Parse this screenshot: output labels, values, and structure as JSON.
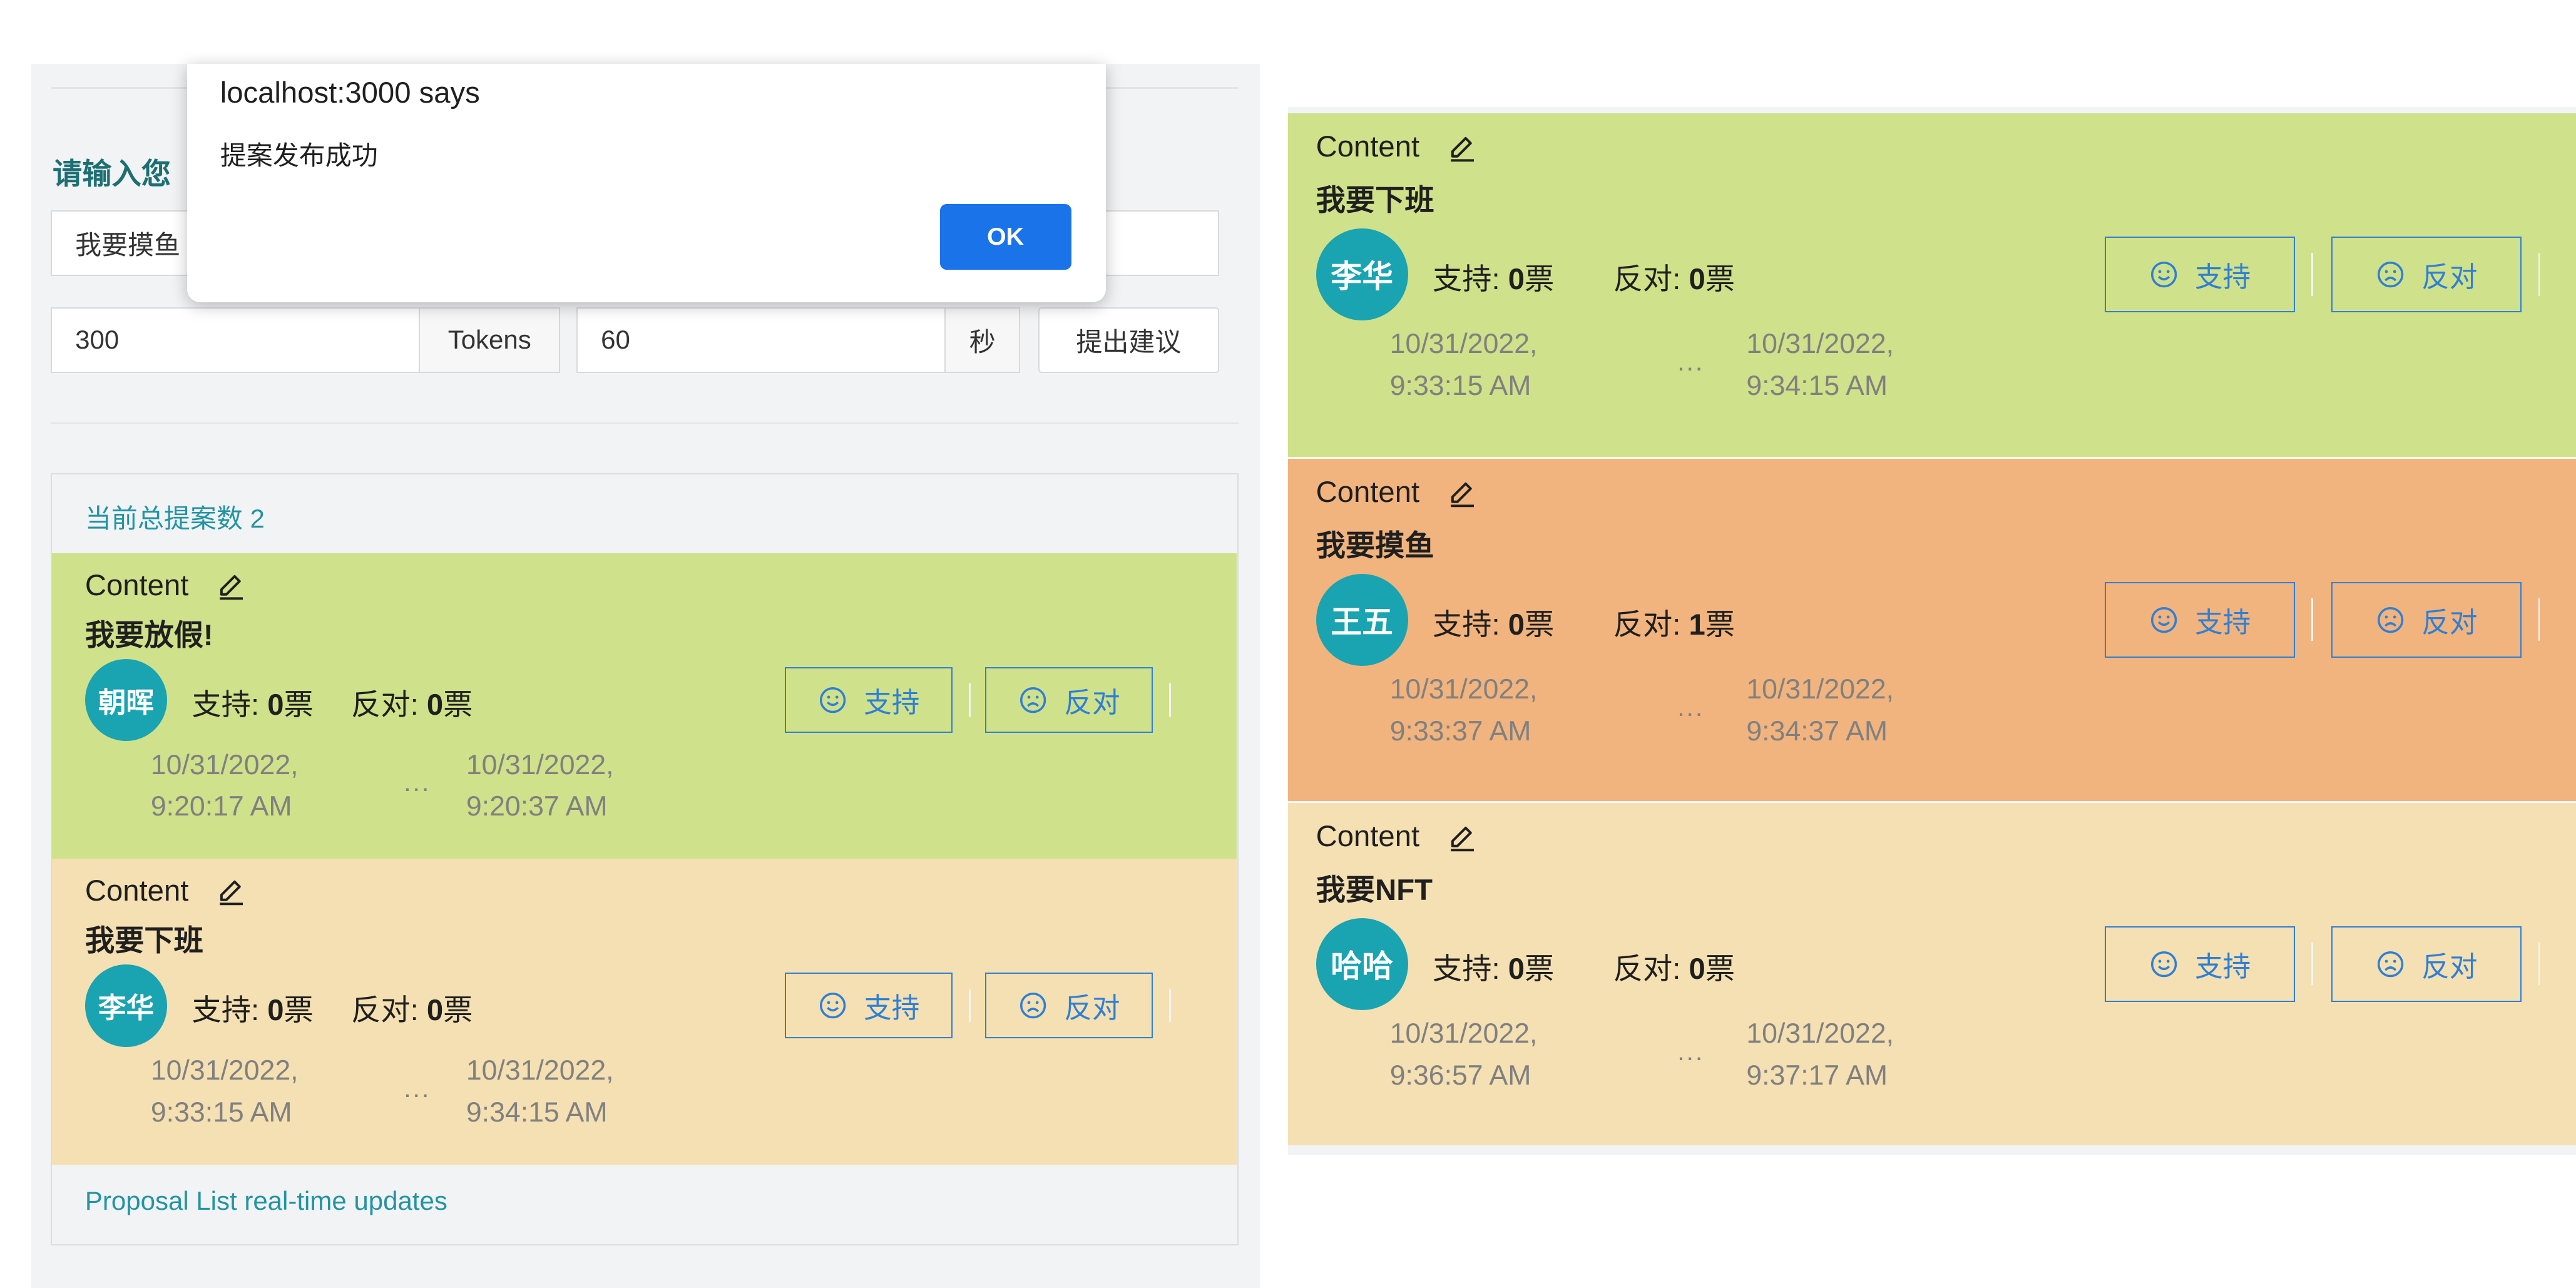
{
  "dialog": {
    "title": "localhost:3000 says",
    "message": "提案发布成功",
    "ok_label": "OK"
  },
  "form": {
    "prompt_title": "请输入您",
    "proposal_value": "我要摸鱼",
    "amount_value": "300",
    "amount_unit": "Tokens",
    "duration_value": "60",
    "duration_unit": "秒",
    "submit_label": "提出建议"
  },
  "list": {
    "header": "当前总提案数 2",
    "footer": "Proposal List real-time updates"
  },
  "vote": {
    "support_prefix": "支持: ",
    "oppose_prefix": "反对: ",
    "unit": "票",
    "support_btn": "支持",
    "oppose_btn": "反对",
    "ellipsis": "..."
  },
  "left_proposals": [
    {
      "label": "Content",
      "text": "我要放假!",
      "avatar": "朝晖",
      "support": "0",
      "oppose": "0",
      "start_date": "10/31/2022,",
      "start_time": "9:20:17 AM",
      "end_date": "10/31/2022,",
      "end_time": "9:20:37 AM"
    },
    {
      "label": "Content",
      "text": "我要下班",
      "avatar": "李华",
      "support": "0",
      "oppose": "0",
      "start_date": "10/31/2022,",
      "start_time": "9:33:15 AM",
      "end_date": "10/31/2022,",
      "end_time": "9:34:15 AM"
    }
  ],
  "right_proposals": [
    {
      "label": "Content",
      "text": "我要下班",
      "avatar": "李华",
      "support": "0",
      "oppose": "0",
      "start_date": "10/31/2022,",
      "start_time": "9:33:15 AM",
      "end_date": "10/31/2022,",
      "end_time": "9:34:15 AM"
    },
    {
      "label": "Content",
      "text": "我要摸鱼",
      "avatar": "王五",
      "support": "0",
      "oppose": "1",
      "start_date": "10/31/2022,",
      "start_time": "9:33:37 AM",
      "end_date": "10/31/2022,",
      "end_time": "9:34:37 AM"
    },
    {
      "label": "Content",
      "text": "我要NFT",
      "avatar": "哈哈",
      "support": "0",
      "oppose": "0",
      "start_date": "10/31/2022,",
      "start_time": "9:36:57 AM",
      "end_date": "10/31/2022,",
      "end_time": "9:37:17 AM"
    }
  ],
  "colors": {
    "card_green": "#cfe18a",
    "card_orange": "#f1b47e",
    "card_beige": "#f4e0b2",
    "avatar": "#1aa3b0",
    "vote_button": "#2f7fd6",
    "link_teal": "#2294a3",
    "dialog_ok": "#1a73e8"
  },
  "icons": {
    "edit": "pencil-icon",
    "support": "smile-icon",
    "oppose": "frown-icon"
  }
}
